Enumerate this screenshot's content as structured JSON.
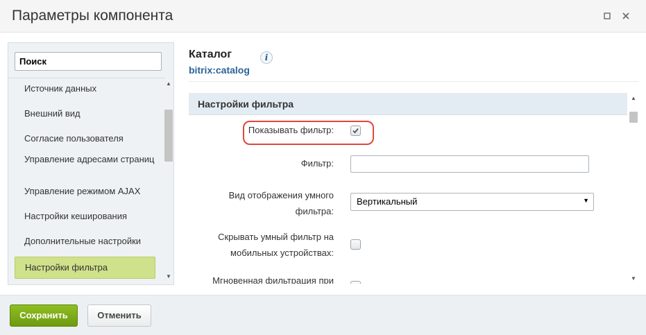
{
  "window": {
    "title": "Параметры компонента",
    "maximize_icon": "□",
    "close_icon": "×"
  },
  "sidebar": {
    "search_placeholder": "Поиск",
    "items": [
      {
        "label": "Источник данных"
      },
      {
        "label": "Внешний вид"
      },
      {
        "label": "Согласие пользователя"
      },
      {
        "label": "Управление адресами страниц"
      },
      {
        "label": "Управление режимом AJAX"
      },
      {
        "label": "Настройки кеширования"
      },
      {
        "label": "Дополнительные настройки"
      },
      {
        "label": "Настройки фильтра"
      }
    ],
    "active_item": "Настройки фильтра"
  },
  "component": {
    "name": "Каталог",
    "code": "bitrix:catalog",
    "info_icon": "i"
  },
  "section": {
    "title": "Настройки фильтра"
  },
  "fields": {
    "show_filter": {
      "label": "Показывать фильтр:",
      "checked": true
    },
    "filter": {
      "label": "Фильтр:",
      "value": ""
    },
    "smart_filter_view": {
      "label_line1": "Вид отображения умного",
      "label_line2": "фильтра:",
      "value": "Вертикальный"
    },
    "hide_on_mobile": {
      "label_line1": "Скрывать умный фильтр на",
      "label_line2": "мобильных устройствах:",
      "checked": false
    },
    "instant_filter": {
      "label": "Мгновенная фильтрация при",
      "checked": false
    }
  },
  "footer": {
    "save_label": "Сохранить",
    "cancel_label": "Отменить"
  },
  "colors": {
    "accent_green": "#7aa817",
    "active_item": "#cfe18a",
    "highlight": "#e0463a",
    "link": "#2a6496"
  }
}
